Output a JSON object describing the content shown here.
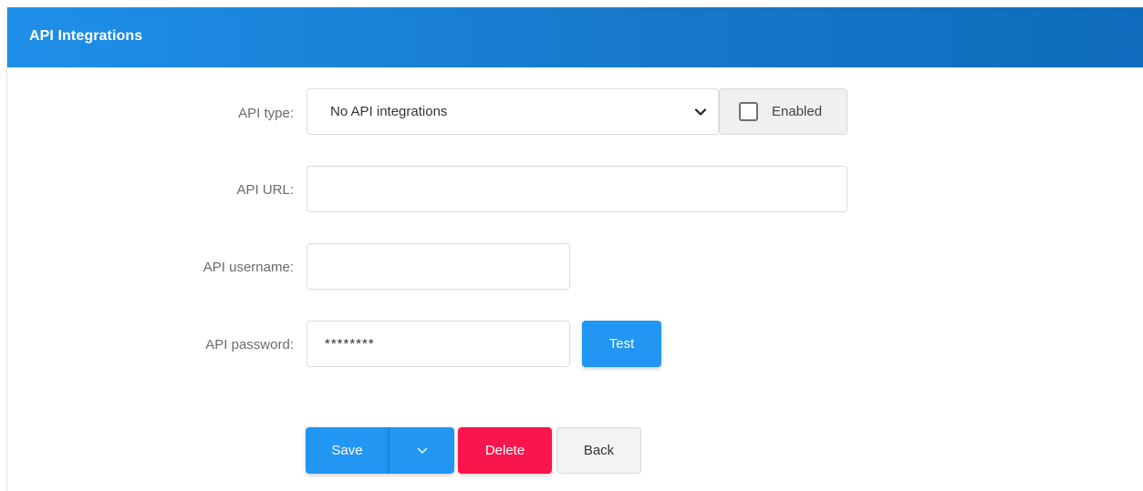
{
  "header": {
    "title": "API Integrations"
  },
  "form": {
    "api_type": {
      "label": "API type:",
      "selected": "No API integrations",
      "options": [
        "No API integrations"
      ],
      "enabled_label": "Enabled",
      "enabled_checked": false
    },
    "api_url": {
      "label": "API URL:",
      "value": ""
    },
    "api_username": {
      "label": "API username:",
      "value": ""
    },
    "api_password": {
      "label": "API password:",
      "value": "********"
    },
    "test_label": "Test"
  },
  "actions": {
    "save_label": "Save",
    "delete_label": "Delete",
    "back_label": "Back"
  },
  "colors": {
    "header": "#1677c8",
    "primary": "#2196f3",
    "danger": "#f9164d",
    "neutral": "#f3f3f3"
  },
  "icons": [
    "chevron-down-icon",
    "checkbox-icon"
  ]
}
